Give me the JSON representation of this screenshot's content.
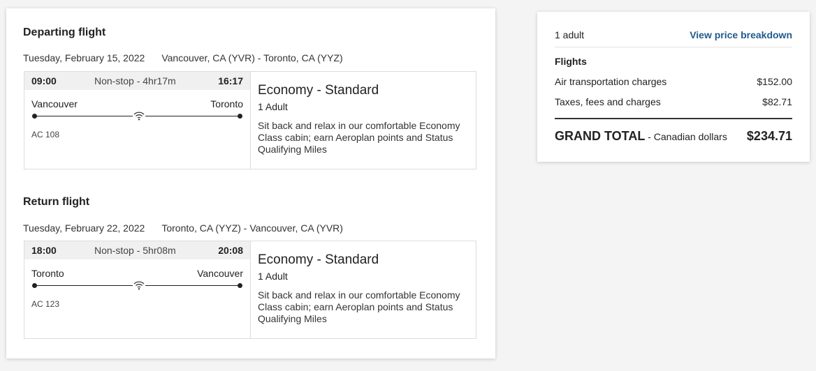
{
  "flights": [
    {
      "section_title": "Departing flight",
      "date": "Tuesday, February 15, 2022",
      "route": "Vancouver, CA (YVR) - Toronto, CA (YYZ)",
      "dep_time": "09:00",
      "duration": "Non-stop - 4hr17m",
      "arr_time": "16:17",
      "from_city": "Vancouver",
      "to_city": "Toronto",
      "flight_number": "AC 108",
      "cabin": "Economy - Standard",
      "passengers": "1 Adult",
      "description": "Sit back and relax in our comfortable Economy Class cabin; earn Aeroplan points and Status Qualifying Miles"
    },
    {
      "section_title": "Return flight",
      "date": "Tuesday, February 22, 2022",
      "route": "Toronto, CA (YYZ) - Vancouver, CA (YVR)",
      "dep_time": "18:00",
      "duration": "Non-stop - 5hr08m",
      "arr_time": "20:08",
      "from_city": "Toronto",
      "to_city": "Vancouver",
      "flight_number": "AC 123",
      "cabin": "Economy - Standard",
      "passengers": "1 Adult",
      "description": "Sit back and relax in our comfortable Economy Class cabin; earn Aeroplan points and Status Qualifying Miles"
    }
  ],
  "price": {
    "adults": "1 adult",
    "breakdown_link": "View price breakdown",
    "flights_heading": "Flights",
    "lines": [
      {
        "label": "Air transportation charges",
        "value": "$152.00"
      },
      {
        "label": "Taxes, fees and charges",
        "value": "$82.71"
      }
    ],
    "grand_total_label": "GRAND TOTAL",
    "grand_total_sub": " - Canadian dollars",
    "grand_total_value": "$234.71"
  },
  "icons": {
    "wifi": "wifi-icon"
  },
  "colors": {
    "link": "#1f5b8c",
    "background": "#f4f4f4"
  }
}
